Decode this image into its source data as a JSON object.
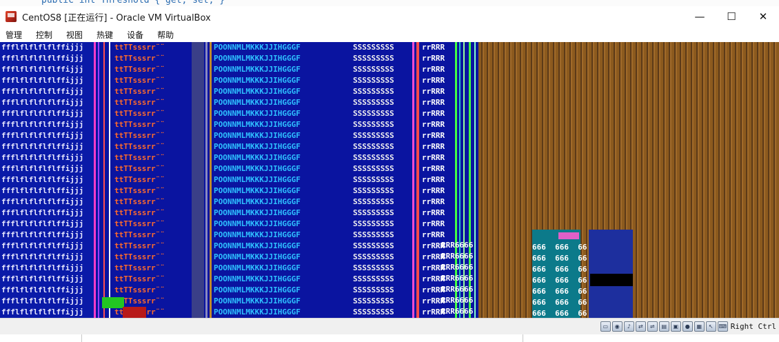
{
  "background_editor": {
    "code_line": "public int Threshold { get; set; }"
  },
  "window": {
    "title": "CentOS8 [正在运行] - Oracle VM VirtualBox",
    "icon": "virtualbox-icon"
  },
  "window_controls": {
    "minimize": "—",
    "maximize": "☐",
    "close": "✕"
  },
  "menu": [
    "管理",
    "控制",
    "视图",
    "热键",
    "设备",
    "帮助"
  ],
  "screen": {
    "col_a": "ffflflflflflffijjj",
    "col_b": "ttTTsssrr¨¨",
    "col_c": "POONNMLMKKKJJIHGGGF",
    "col_d": "SSSSSSSSS",
    "col_e": "rrRRR",
    "col_f": "RRR6666",
    "col_g": "666  666  66"
  },
  "status": {
    "icons": [
      "hdd-icon",
      "optical-icon",
      "audio-icon",
      "network-icon",
      "usb-icon",
      "shared-folder-icon",
      "display-icon",
      "recording-icon",
      "cpu-icon",
      "mouse-icon",
      "keyboard-icon"
    ],
    "host_key": "Right Ctrl"
  }
}
